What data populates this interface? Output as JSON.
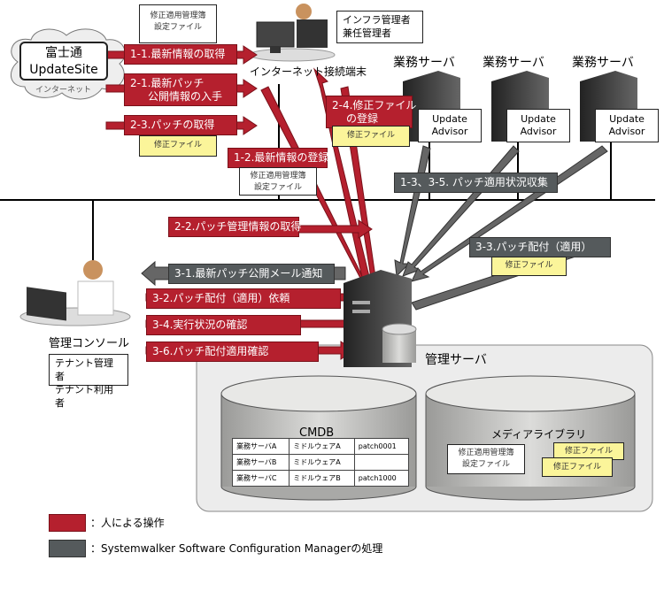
{
  "colors": {
    "human_op": "#b5202e",
    "system_op": "#555a5c",
    "note_yellow": "#fbf59a"
  },
  "cloud": {
    "title_line1": "富士通",
    "title_line2": "UpdateSite",
    "caption": "インターネット"
  },
  "terminal": {
    "label": "インターネット接続端末",
    "role_line1": "インフラ管理者",
    "role_line2": "兼任管理者"
  },
  "notes": {
    "config_line1": "修正適用管理簿",
    "config_line2": "設定ファイル",
    "patch_file": "修正ファイル"
  },
  "steps": {
    "s1_1": "1-1.最新情報の取得",
    "s1_2": "1-2.最新情報の登録",
    "s2_1_line1": "2-1.最新パッチ",
    "s2_1_line2": "公開情報の入手",
    "s2_2": "2-2.パッチ管理情報の取得",
    "s2_3": "2-3.パッチの取得",
    "s2_4_line1": "2-4.修正ファイル",
    "s2_4_line2": "の登録",
    "s1_3": "1-3、3-5. パッチ適用状況収集",
    "s3_1": "3-1.最新パッチ公開メール通知",
    "s3_2": "3-2.パッチ配付（適用）依頼",
    "s3_3": "3-3.パッチ配付（適用）",
    "s3_4": "3-4.実行状況の確認",
    "s3_6": "3-6.パッチ配付適用確認"
  },
  "servers": [
    {
      "label": "業務サーバ",
      "agent_line1": "Update",
      "agent_line2": "Advisor"
    },
    {
      "label": "業務サーバ",
      "agent_line1": "Update",
      "agent_line2": "Advisor"
    },
    {
      "label": "業務サーバ",
      "agent_line1": "Update",
      "agent_line2": "Advisor"
    }
  ],
  "console": {
    "label": "管理コンソール",
    "role_line1": "テナント管理者",
    "role_line2": "テナント利用者"
  },
  "mgmt_server": {
    "label": "管理サーバ"
  },
  "cmdb": {
    "title": "CMDB",
    "rows": [
      [
        "業務サーバA",
        "ミドルウェアA",
        "patch0001"
      ],
      [
        "業務サーバB",
        "ミドルウェアA",
        ""
      ],
      [
        "業務サーバC",
        "ミドルウェアB",
        "patch1000"
      ]
    ]
  },
  "media_library": {
    "title": "メディアライブラリ"
  },
  "legend": [
    {
      "color": "#b5202e",
      "text": "：人による操作"
    },
    {
      "color": "#555a5c",
      "text": "：Systemwalker Software Configuration Managerの処理"
    }
  ]
}
